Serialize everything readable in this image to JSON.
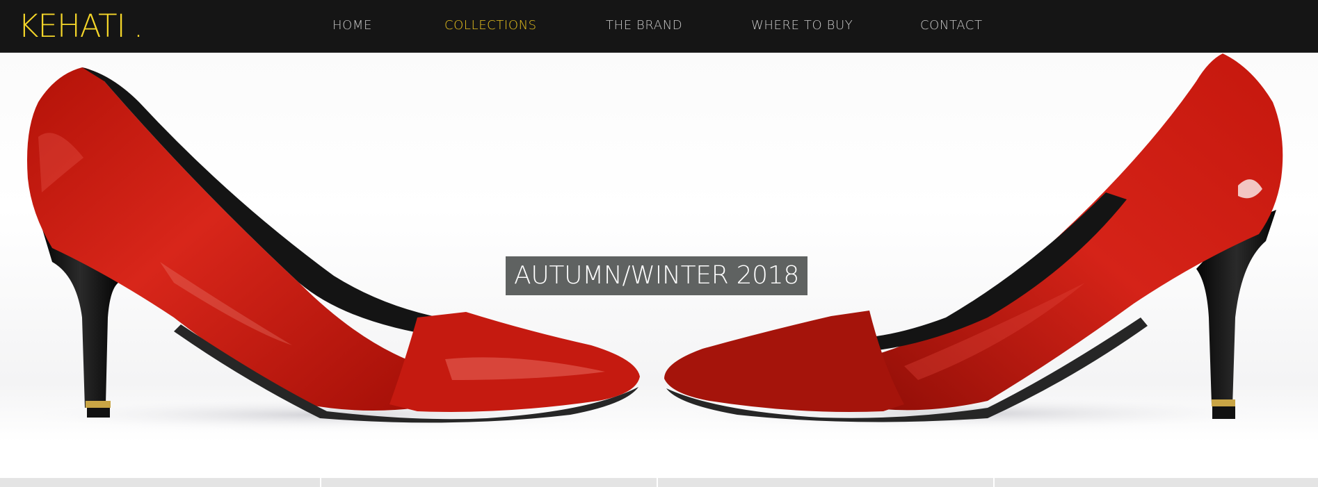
{
  "brand": {
    "name": "KEHATI",
    "suffix": ".",
    "color": "#f5d629"
  },
  "nav": {
    "items": [
      {
        "label": "HOME",
        "active": false
      },
      {
        "label": "COLLECTIONS",
        "active": true
      },
      {
        "label": "THE BRAND",
        "active": false
      },
      {
        "label": "WHERE TO BUY",
        "active": false
      },
      {
        "label": "CONTACT",
        "active": false
      }
    ],
    "active_color": "#e8c21e",
    "text_color": "#c9c9c9"
  },
  "hero": {
    "banner_text": "AUTUMN/WINTER 2018",
    "image": "red-high-heel-pumps-facing-each-other"
  },
  "colors": {
    "topbar_bg": "#151515",
    "banner_bg": "#5f6261",
    "shoe_red": "#c8190f"
  }
}
